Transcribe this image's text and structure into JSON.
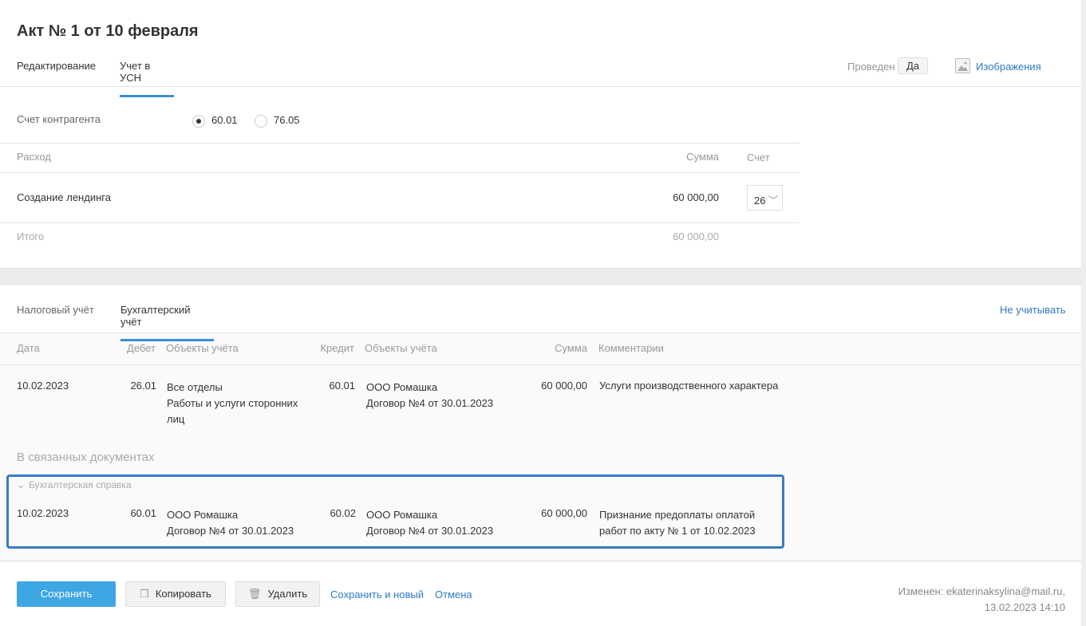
{
  "title": "Акт № 1 от 10 февраля",
  "tabs": [
    "Редактирование",
    "Учет в УСН"
  ],
  "status_label": "Проведен",
  "status_value": "Да",
  "images_link": "Изображения",
  "counterparty_label": "Счет контрагента",
  "radio_options": [
    "60.01",
    "76.05"
  ],
  "expense_table": {
    "headers": [
      "Расход",
      "Сумма",
      "Счет"
    ],
    "row": {
      "name": "Создание лендинга",
      "sum": "60 000,00",
      "account": "26"
    },
    "total_label": "Итого",
    "total": "60 000,00"
  },
  "lower_tabs": [
    "Налоговый учёт",
    "Бухгалтерский учёт"
  ],
  "ignore_link": "Не учитывать",
  "entries_headers": [
    "Дата",
    "Дебет",
    "Объекты учёта",
    "Кредит",
    "Объекты учёта",
    "Сумма",
    "Комментарии"
  ],
  "entry": {
    "date": "10.02.2023",
    "debit": "26.01",
    "debit_obj1": "Все отделы",
    "debit_obj2": "Работы и услуги сторонних",
    "debit_obj3": "лиц",
    "credit": "60.01",
    "credit_obj1": "ООО Ромашка",
    "credit_obj2": "Договор №4 от 30.01.2023",
    "sum": "60 000,00",
    "comment": "Услуги производственного характера"
  },
  "linked_title": "В связанных документах",
  "linked": {
    "doc": "Бухгалтерская справка",
    "date": "10.02.2023",
    "debit": "60.01",
    "debit_obj1": "ООО Ромашка",
    "debit_obj2": "Договор №4 от 30.01.2023",
    "credit": "60.02",
    "credit_obj1": "ООО Ромашка",
    "credit_obj2": "Договор №4 от 30.01.2023",
    "sum": "60 000,00",
    "comment1": "Признание предоплаты оплатой",
    "comment2": "работ по акту № 1 от 10.02.2023"
  },
  "buttons": {
    "save": "Сохранить",
    "copy": "Копировать",
    "delete": "Удалить",
    "save_new": "Сохранить и новый",
    "cancel": "Отмена"
  },
  "modified": {
    "line1": "Изменен: ekaterinaksylina@mail.ru,",
    "line2": "13.02.2023 14:10"
  }
}
